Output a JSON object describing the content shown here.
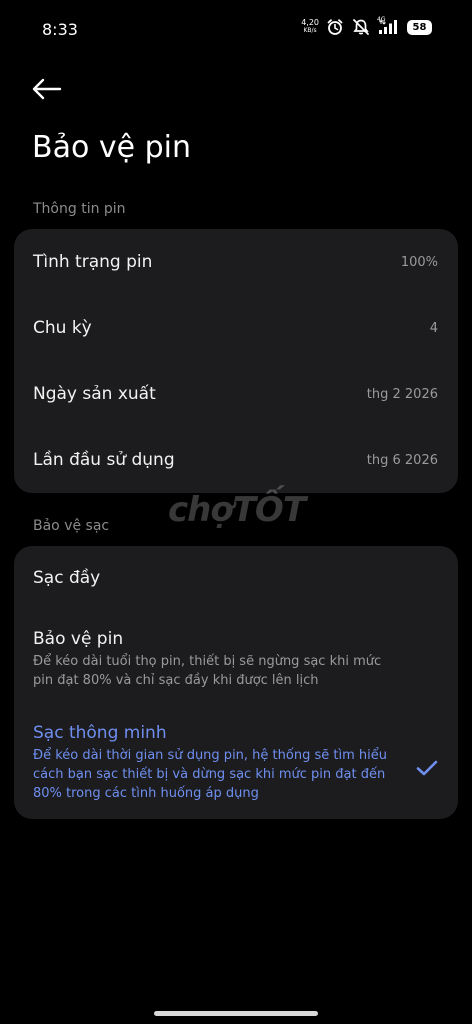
{
  "status_bar": {
    "time": "8:33",
    "net_speed_value": "4,20",
    "net_speed_unit": "KB/s",
    "signal_label": "4G",
    "battery": "58"
  },
  "header": {
    "title": "Bảo vệ pin"
  },
  "battery_info": {
    "section_label": "Thông tin pin",
    "rows": [
      {
        "label": "Tình trạng pin",
        "value": "100%"
      },
      {
        "label": "Chu kỳ",
        "value": "4"
      },
      {
        "label": "Ngày sản xuất",
        "value": "thg 2 2026"
      },
      {
        "label": "Lần đầu sử dụng",
        "value": "thg 6 2026"
      }
    ]
  },
  "charge_protection": {
    "section_label": "Bảo vệ sạc",
    "options": [
      {
        "title": "Sạc đầy",
        "description": ""
      },
      {
        "title": "Bảo vệ pin",
        "description": "Để kéo dài tuổi thọ pin, thiết bị sẽ ngừng sạc khi mức pin đạt 80% và chỉ sạc đầy khi được lên lịch"
      },
      {
        "title": "Sạc thông minh",
        "description": "Để kéo dài thời gian sử dụng pin, hệ thống sẽ tìm hiểu cách bạn sạc thiết bị và dừng sạc khi mức pin đạt đến 80% trong các tình huống áp dụng"
      }
    ],
    "selected_index": 2
  },
  "watermark": "chợTỐT",
  "accent_color": "#6f8ff0"
}
